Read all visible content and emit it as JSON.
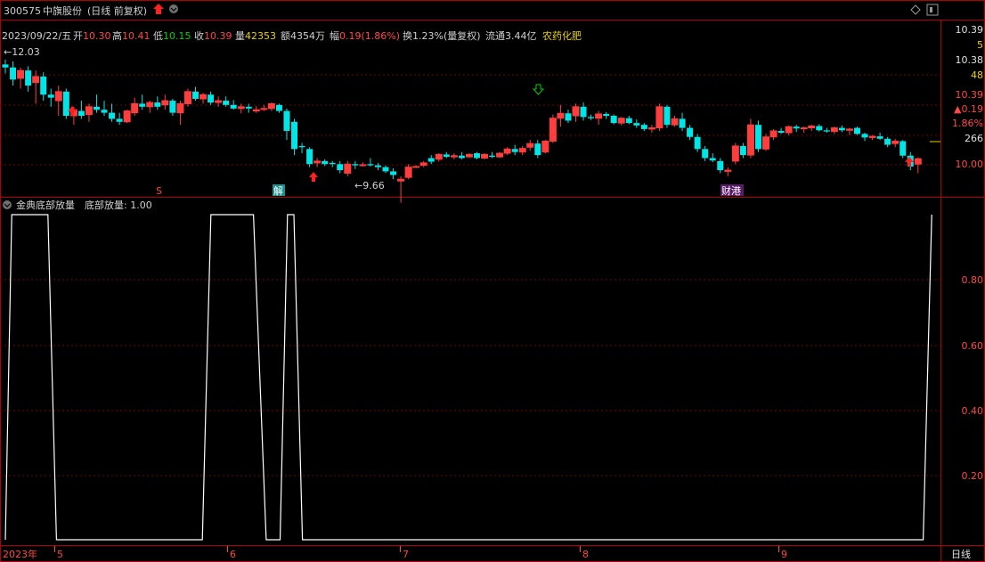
{
  "header": {
    "code": "300575",
    "name": "中旗股份",
    "mode": "(日线 前复权)"
  },
  "info_bar": {
    "date": "2023/09/22/五",
    "open_label": "开",
    "open": "10.30",
    "high_label": "高",
    "high": "10.41",
    "low_label": "低",
    "low": "10.15",
    "close_label": "收",
    "close": "10.39",
    "vol_label": "量",
    "vol": "42353",
    "amount_label": "额",
    "amount": "4354万",
    "change_label": "幅",
    "change": "0.19(1.86%)",
    "turnover_label": "换",
    "turnover": "1.23%(量复权)",
    "float_label": "流通",
    "float": "3.44亿",
    "sector": "农药化肥"
  },
  "price_axis": {
    "labels": [
      "10.39",
      "10.38",
      "10.00"
    ],
    "side_values": [
      "5",
      "48",
      "10.39",
      "▲0.19",
      "1.86%",
      "266"
    ]
  },
  "price_annotations": {
    "max_label": "12.03",
    "min_label": "9.66",
    "tags": [
      "S",
      "解",
      "财港"
    ]
  },
  "indicator": {
    "title": "金典底部放量",
    "value_text": "底部放量: 1.00",
    "labels": [
      "0.80",
      "0.60",
      "0.40",
      "0.20"
    ]
  },
  "time_axis": {
    "labels": [
      "2023年",
      "5",
      "6",
      "7",
      "8",
      "9"
    ],
    "period_label": "日线"
  },
  "colors": {
    "up": "#ff3d3d",
    "down": "#00e5e5",
    "line": "#ffffff",
    "grid": "#7a0000",
    "border": "#b00000",
    "label_red": "#ff4646",
    "label_yellow": "#e8d000",
    "label_green": "#00d000"
  },
  "chart_data": [
    {
      "type": "candlestick",
      "title": "",
      "ylim": [
        9.95,
        12.25
      ],
      "candles": [
        [
          11.95,
          12.03,
          11.8,
          11.9
        ],
        [
          11.9,
          12.0,
          11.6,
          11.7
        ],
        [
          11.72,
          11.9,
          11.55,
          11.85
        ],
        [
          11.85,
          11.92,
          11.5,
          11.6
        ],
        [
          11.65,
          11.85,
          11.3,
          11.75
        ],
        [
          11.75,
          11.82,
          11.35,
          11.45
        ],
        [
          11.45,
          11.55,
          11.25,
          11.4
        ],
        [
          11.35,
          11.6,
          11.1,
          11.5
        ],
        [
          11.5,
          11.55,
          11.05,
          11.1
        ],
        [
          11.1,
          11.25,
          10.95,
          11.2
        ],
        [
          11.18,
          11.35,
          11.05,
          11.1
        ],
        [
          11.12,
          11.3,
          11.0,
          11.25
        ],
        [
          11.25,
          11.45,
          11.15,
          11.2
        ],
        [
          11.2,
          11.35,
          11.1,
          11.15
        ],
        [
          11.15,
          11.3,
          11.0,
          11.05
        ],
        [
          11.05,
          11.15,
          10.95,
          11.0
        ],
        [
          11.0,
          11.2,
          10.98,
          11.18
        ],
        [
          11.15,
          11.4,
          11.1,
          11.3
        ],
        [
          11.3,
          11.45,
          11.2,
          11.25
        ],
        [
          11.25,
          11.35,
          11.15,
          11.32
        ],
        [
          11.32,
          11.42,
          11.2,
          11.25
        ],
        [
          11.28,
          11.45,
          11.2,
          11.35
        ],
        [
          11.35,
          11.38,
          11.1,
          11.15
        ],
        [
          11.15,
          11.35,
          10.95,
          11.3
        ],
        [
          11.3,
          11.55,
          11.25,
          11.5
        ],
        [
          11.5,
          11.58,
          11.35,
          11.38
        ],
        [
          11.38,
          11.48,
          11.3,
          11.45
        ],
        [
          11.45,
          11.5,
          11.28,
          11.32
        ],
        [
          11.32,
          11.42,
          11.25,
          11.35
        ],
        [
          11.35,
          11.42,
          11.25,
          11.28
        ],
        [
          11.28,
          11.36,
          11.2,
          11.22
        ],
        [
          11.22,
          11.3,
          11.14,
          11.25
        ],
        [
          11.25,
          11.3,
          11.15,
          11.22
        ],
        [
          11.18,
          11.26,
          11.15,
          11.2
        ],
        [
          11.22,
          11.28,
          11.18,
          11.22
        ],
        [
          11.22,
          11.32,
          11.18,
          11.3
        ],
        [
          11.28,
          11.3,
          11.15,
          11.18
        ],
        [
          11.18,
          11.22,
          10.7,
          10.85
        ],
        [
          11.0,
          11.05,
          10.45,
          10.55
        ],
        [
          10.6,
          10.65,
          10.48,
          10.58
        ],
        [
          10.55,
          10.58,
          10.25,
          10.3
        ],
        [
          10.32,
          10.4,
          10.25,
          10.35
        ],
        [
          10.35,
          10.38,
          10.27,
          10.3
        ],
        [
          10.32,
          10.35,
          10.25,
          10.3
        ],
        [
          10.3,
          10.35,
          10.15,
          10.2
        ],
        [
          10.15,
          10.35,
          10.1,
          10.3
        ],
        [
          10.3,
          10.35,
          10.22,
          10.28
        ],
        [
          10.28,
          10.33,
          10.26,
          10.29
        ],
        [
          10.3,
          10.4,
          10.26,
          10.28
        ],
        [
          10.28,
          10.32,
          10.2,
          10.25
        ],
        [
          10.25,
          10.28,
          10.15,
          10.18
        ],
        [
          10.18,
          10.23,
          10.05,
          10.12
        ],
        [
          10.02,
          10.1,
          9.66,
          10.05
        ],
        [
          10.08,
          10.3,
          10.05,
          10.25
        ],
        [
          10.25,
          10.28,
          10.24,
          10.26
        ],
        [
          10.28,
          10.35,
          10.25,
          10.32
        ],
        [
          10.4,
          10.45,
          10.3,
          10.34
        ],
        [
          10.38,
          10.48,
          10.34,
          10.46
        ],
        [
          10.46,
          10.5,
          10.4,
          10.42
        ],
        [
          10.42,
          10.48,
          10.38,
          10.44
        ],
        [
          10.44,
          10.5,
          10.38,
          10.4
        ],
        [
          10.42,
          10.48,
          10.4,
          10.46
        ],
        [
          10.48,
          10.5,
          10.38,
          10.4
        ],
        [
          10.4,
          10.48,
          10.38,
          10.46
        ],
        [
          10.44,
          10.5,
          10.4,
          10.42
        ],
        [
          10.42,
          10.5,
          10.4,
          10.48
        ],
        [
          10.48,
          10.58,
          10.45,
          10.55
        ],
        [
          10.55,
          10.62,
          10.45,
          10.5
        ],
        [
          10.5,
          10.6,
          10.45,
          10.56
        ],
        [
          10.58,
          10.7,
          10.52,
          10.64
        ],
        [
          10.64,
          10.7,
          10.4,
          10.45
        ],
        [
          10.5,
          10.7,
          10.48,
          10.68
        ],
        [
          10.68,
          11.12,
          10.65,
          11.06
        ],
        [
          11.06,
          11.28,
          10.92,
          11.14
        ],
        [
          11.14,
          11.2,
          10.98,
          11.02
        ],
        [
          11.1,
          11.3,
          11.0,
          11.25
        ],
        [
          11.25,
          11.32,
          11.02,
          11.08
        ],
        [
          11.08,
          11.12,
          11.03,
          11.06
        ],
        [
          11.06,
          11.18,
          10.95,
          11.13
        ],
        [
          11.13,
          11.16,
          11.05,
          11.1
        ],
        [
          11.1,
          11.12,
          10.96,
          10.98
        ],
        [
          10.98,
          11.08,
          10.94,
          11.06
        ],
        [
          11.06,
          11.1,
          10.96,
          10.98
        ],
        [
          10.98,
          11.04,
          10.9,
          10.94
        ],
        [
          10.95,
          10.98,
          10.85,
          10.88
        ],
        [
          10.88,
          10.95,
          10.82,
          10.9
        ],
        [
          10.9,
          11.3,
          10.85,
          11.25
        ],
        [
          11.25,
          11.28,
          10.9,
          10.95
        ],
        [
          10.95,
          11.1,
          10.92,
          11.05
        ],
        [
          11.05,
          11.15,
          10.85,
          10.9
        ],
        [
          10.9,
          10.95,
          10.7,
          10.75
        ],
        [
          10.75,
          10.8,
          10.5,
          10.55
        ],
        [
          10.55,
          10.6,
          10.35,
          10.4
        ],
        [
          10.4,
          10.48,
          10.33,
          10.36
        ],
        [
          10.35,
          10.4,
          10.15,
          10.2
        ],
        [
          10.18,
          10.25,
          10.1,
          10.2
        ],
        [
          10.35,
          10.65,
          10.3,
          10.6
        ],
        [
          10.6,
          10.65,
          10.4,
          10.45
        ],
        [
          10.45,
          11.05,
          10.4,
          10.95
        ],
        [
          10.95,
          11.02,
          10.5,
          10.55
        ],
        [
          10.55,
          10.8,
          10.52,
          10.75
        ],
        [
          10.75,
          10.88,
          10.7,
          10.85
        ],
        [
          10.85,
          10.9,
          10.8,
          10.82
        ],
        [
          10.82,
          10.94,
          10.78,
          10.92
        ],
        [
          10.92,
          10.95,
          10.83,
          10.89
        ],
        [
          10.89,
          10.92,
          10.82,
          10.9
        ],
        [
          10.9,
          10.95,
          10.85,
          10.93
        ],
        [
          10.93,
          10.96,
          10.84,
          10.86
        ],
        [
          10.86,
          10.9,
          10.82,
          10.84
        ],
        [
          10.84,
          10.92,
          10.8,
          10.9
        ],
        [
          10.9,
          10.94,
          10.83,
          10.86
        ],
        [
          10.86,
          10.9,
          10.78,
          10.88
        ],
        [
          10.9,
          10.92,
          10.78,
          10.8
        ],
        [
          10.8,
          10.82,
          10.68,
          10.74
        ],
        [
          10.74,
          10.78,
          10.7,
          10.76
        ],
        [
          10.76,
          10.82,
          10.7,
          10.72
        ],
        [
          10.72,
          10.75,
          10.58,
          10.62
        ],
        [
          10.64,
          10.72,
          10.58,
          10.68
        ],
        [
          10.68,
          10.7,
          10.4,
          10.44
        ],
        [
          10.44,
          10.5,
          10.2,
          10.26
        ],
        [
          10.3,
          10.41,
          10.15,
          10.39
        ]
      ]
    },
    {
      "type": "line",
      "title": "金典底部放量",
      "ylim": [
        0,
        1.0
      ],
      "series": [
        {
          "name": "底部放量",
          "x": [
            0,
            0.6,
            2.3,
            4.0,
            4.8,
            18.5,
            19.3,
            20.8,
            23.3,
            24.5,
            25.8,
            26.5,
            27.1,
            27.9,
            29.1,
            86.2,
            87.0
          ],
          "values": [
            0,
            1,
            1,
            1,
            0,
            0,
            1,
            1,
            1,
            0,
            0,
            1,
            1,
            0,
            0,
            0,
            1
          ]
        }
      ]
    }
  ]
}
